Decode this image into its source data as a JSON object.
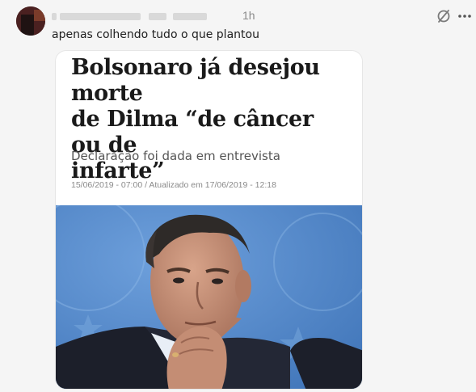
{
  "post": {
    "time": "1h",
    "text": "apenas colhendo tudo o que plantou",
    "icons": {
      "translate": "translate-icon",
      "more": "more-icon"
    }
  },
  "article": {
    "headline_line1": "Bolsonaro já desejou morte",
    "headline_line2": "de Dilma “de câncer ou de",
    "headline_line3": "infarte”",
    "subhead": "Declaração foi dada em entrevista",
    "dateline": "15/06/2019 - 07:00 / Atualizado em 17/06/2019 - 12:18"
  },
  "colors": {
    "background": "#f5f5f5",
    "card": "#ffffff",
    "photo_sky": "#4f86c8"
  }
}
